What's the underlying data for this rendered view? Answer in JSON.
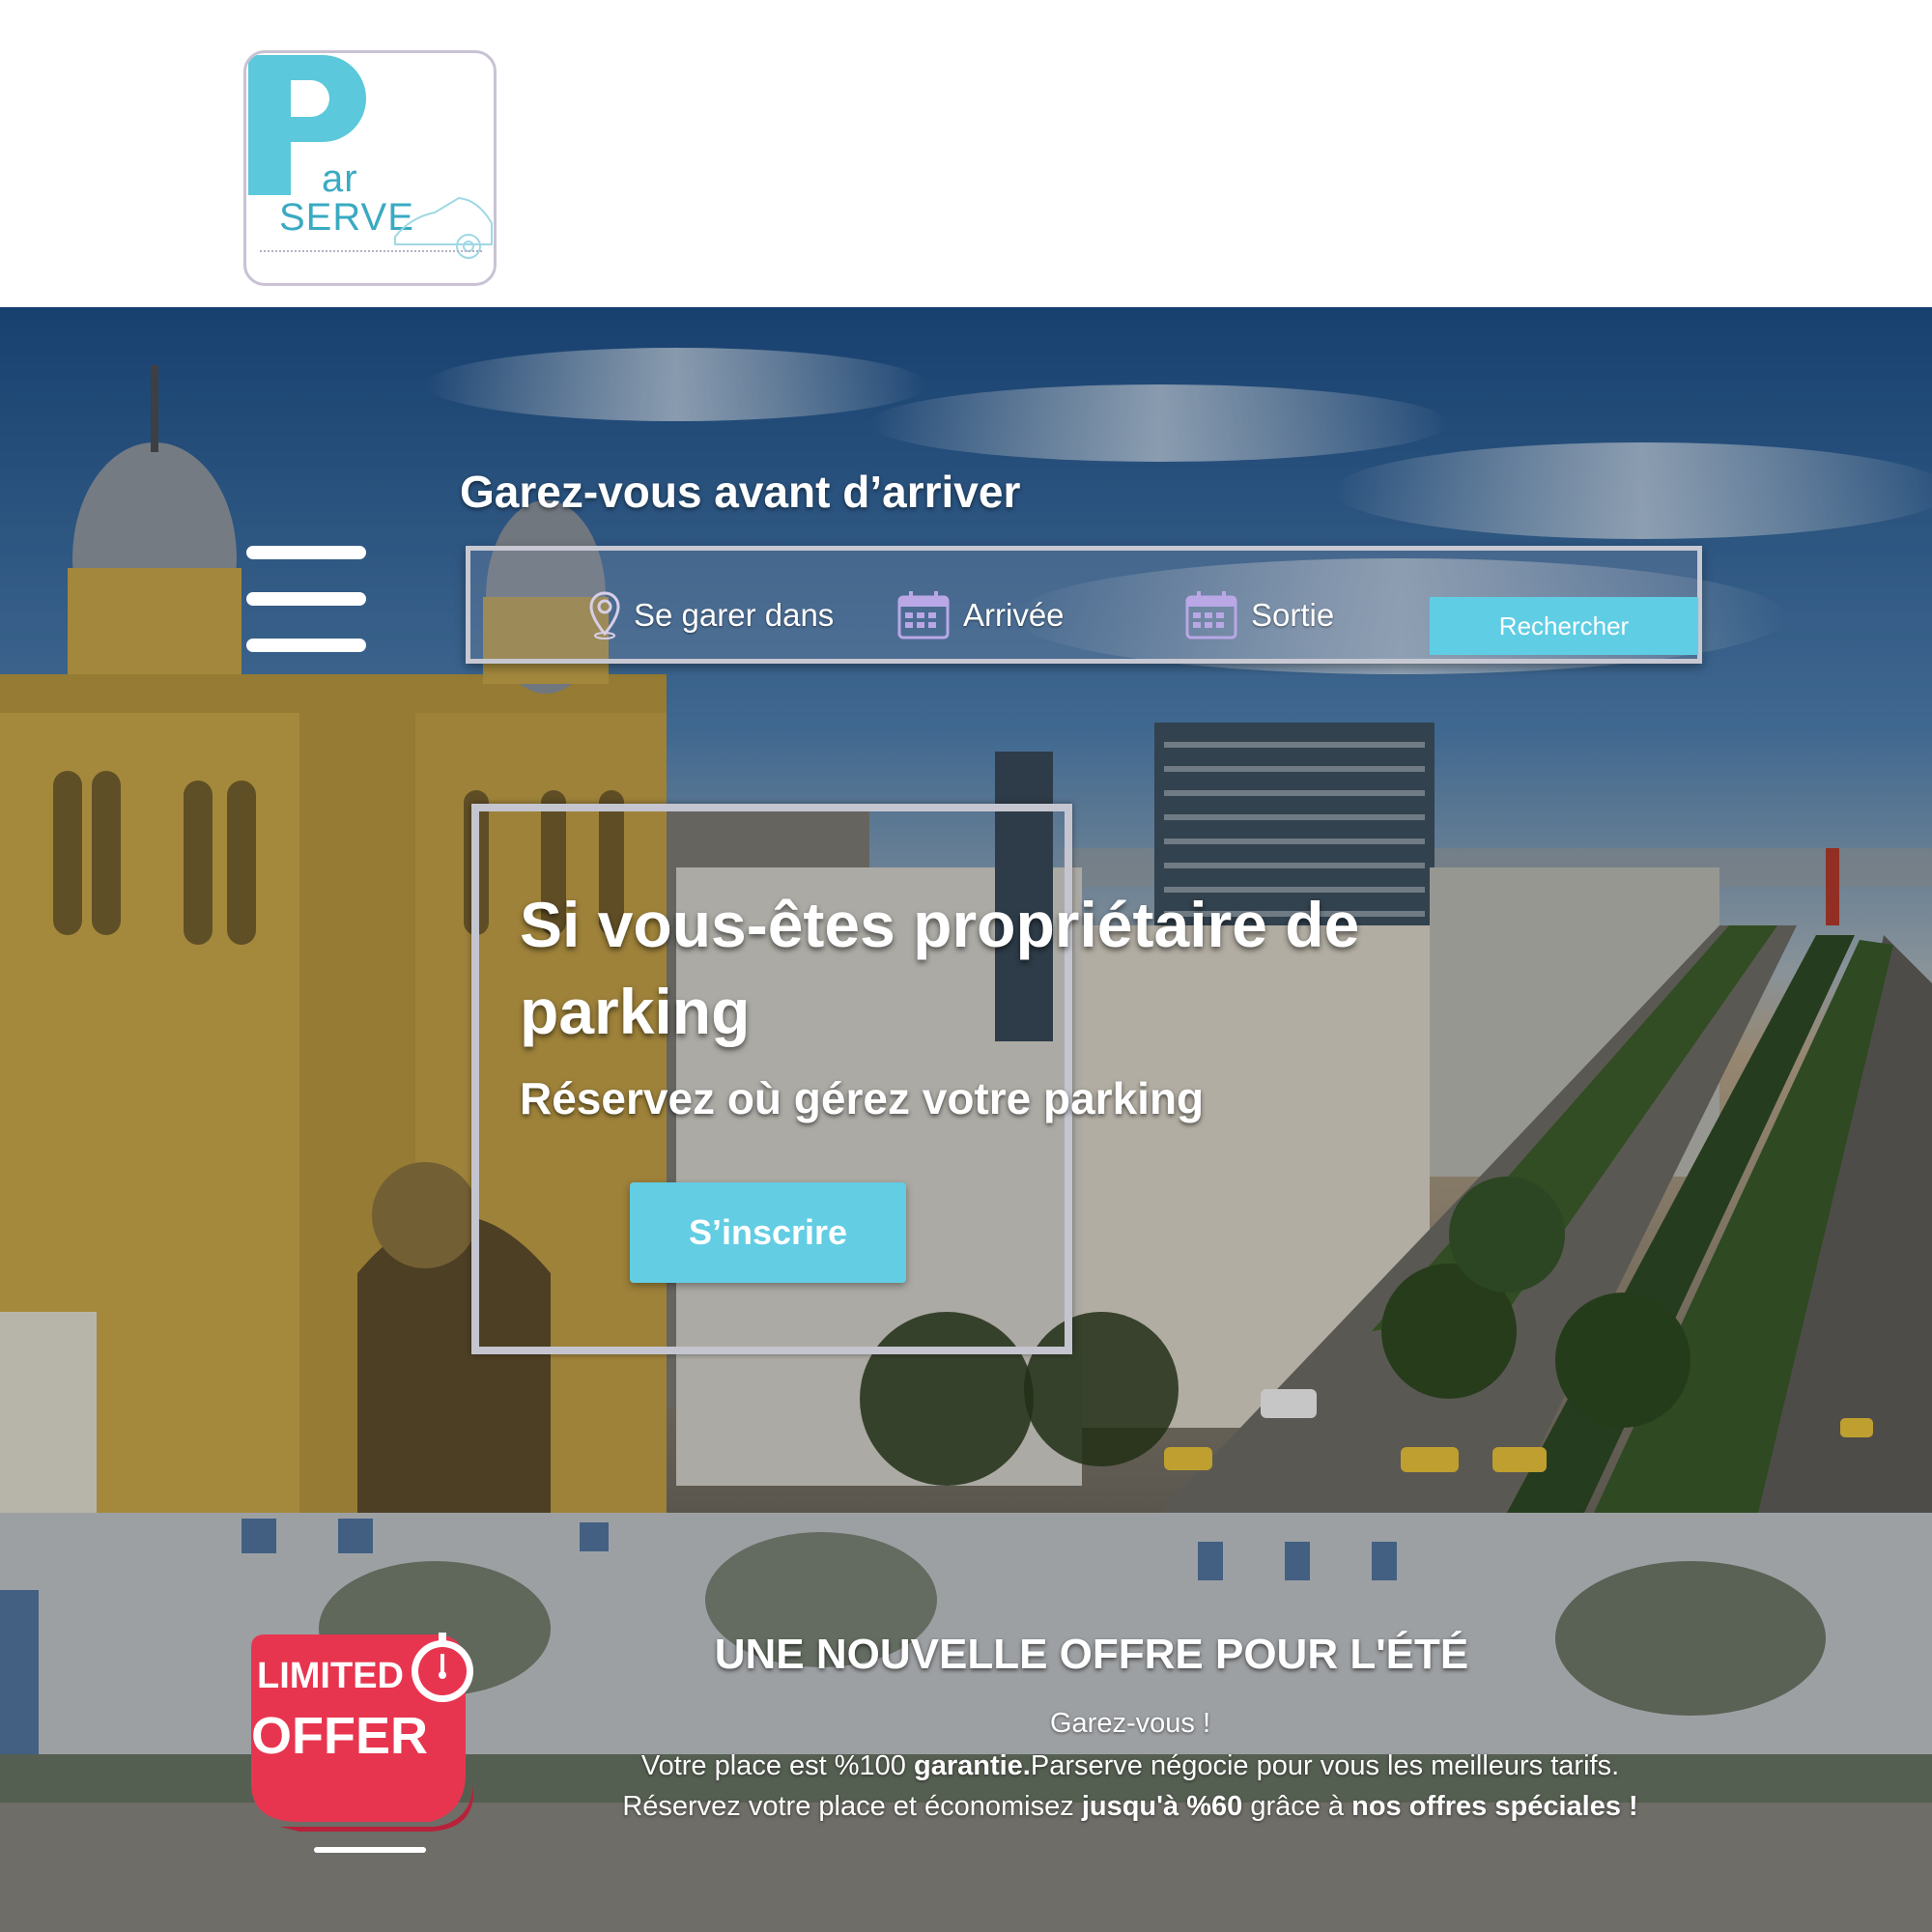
{
  "logo": {
    "letter": "P",
    "line1": "ar",
    "line2": "SERVE"
  },
  "hero": {
    "tagline": "Garez-vous avant d’arriver",
    "search": {
      "location_label": "Se garer dans",
      "arrival_label": "Arrivée",
      "exit_label": "Sortie",
      "button_label": "Rechercher"
    },
    "owner_title": "Si vous-êtes propriétaire de parking",
    "owner_subtitle": "Réservez où gérez votre parking",
    "signup_label": "S’inscrire"
  },
  "offer": {
    "badge_line1": "LIMITED",
    "badge_line2": "OFFER",
    "title": "UNE NOUVELLE OFFRE POUR L'ÉTÉ",
    "line1": "Garez-vous !",
    "line2_a": "Votre place est %100 ",
    "line2_b": "garantie.",
    "line2_c": "Parserve négocie pour vous les meilleurs tarifs.",
    "line3_a": "Réservez votre place et économisez ",
    "line3_b": "jusqu'à %60",
    "line3_c": " grâce à ",
    "line3_d": "nos offres spéciales !"
  },
  "colors": {
    "accent": "#5fcde4",
    "badge_red": "#e8354f",
    "logo_cyan": "#5bc8db"
  },
  "icons": {
    "location": "map-pin-icon",
    "arrival": "calendar-icon",
    "exit": "calendar-icon",
    "menu": "hamburger-menu-icon",
    "badge": "stopwatch-icon"
  }
}
